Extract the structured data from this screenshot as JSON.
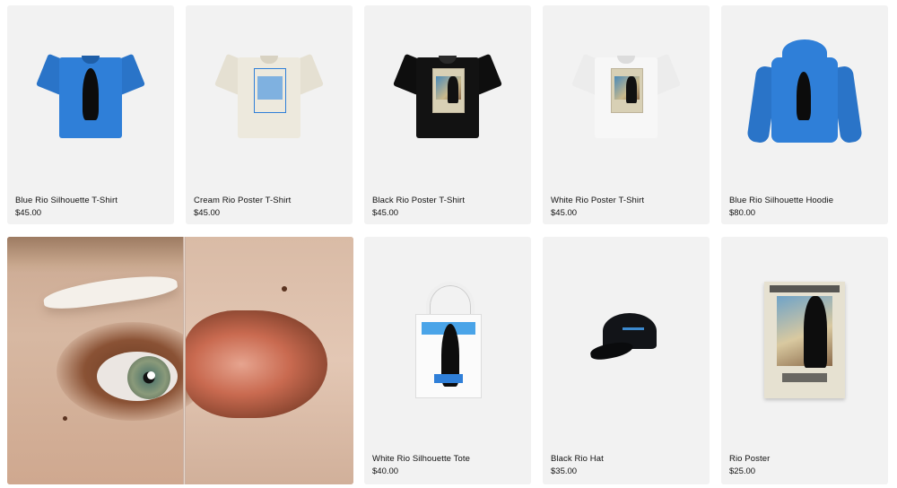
{
  "products": [
    {
      "name": "Blue Rio Silhouette T-Shirt",
      "price": "$45.00",
      "art": "blue-tee",
      "color": "#2f7fd8"
    },
    {
      "name": "Cream Rio Poster T-Shirt",
      "price": "$45.00",
      "art": "cream-tee",
      "color": "#ede9dd"
    },
    {
      "name": "Black Rio Poster T-Shirt",
      "price": "$45.00",
      "art": "black-tee",
      "color": "#121212"
    },
    {
      "name": "White Rio Poster T-Shirt",
      "price": "$45.00",
      "art": "white-tee",
      "color": "#f7f7f7"
    },
    {
      "name": "Blue Rio Silhouette Hoodie",
      "price": "$80.00",
      "art": "blue-hoodie",
      "color": "#2f7fd8"
    },
    {
      "name": "White Rio Silhouette Tote",
      "price": "$40.00",
      "art": "tote",
      "color": "#fbfbfb"
    },
    {
      "name": "Black Rio Hat",
      "price": "$35.00",
      "art": "hat",
      "color": "#121418"
    },
    {
      "name": "Rio Poster",
      "price": "$25.00",
      "art": "poster",
      "color": "#e6e1d1"
    }
  ],
  "hero": {
    "art": "close-up-eye-and-lips-collage"
  },
  "theme": {
    "card_bg": "#f2f2f2",
    "text": "#111111"
  }
}
